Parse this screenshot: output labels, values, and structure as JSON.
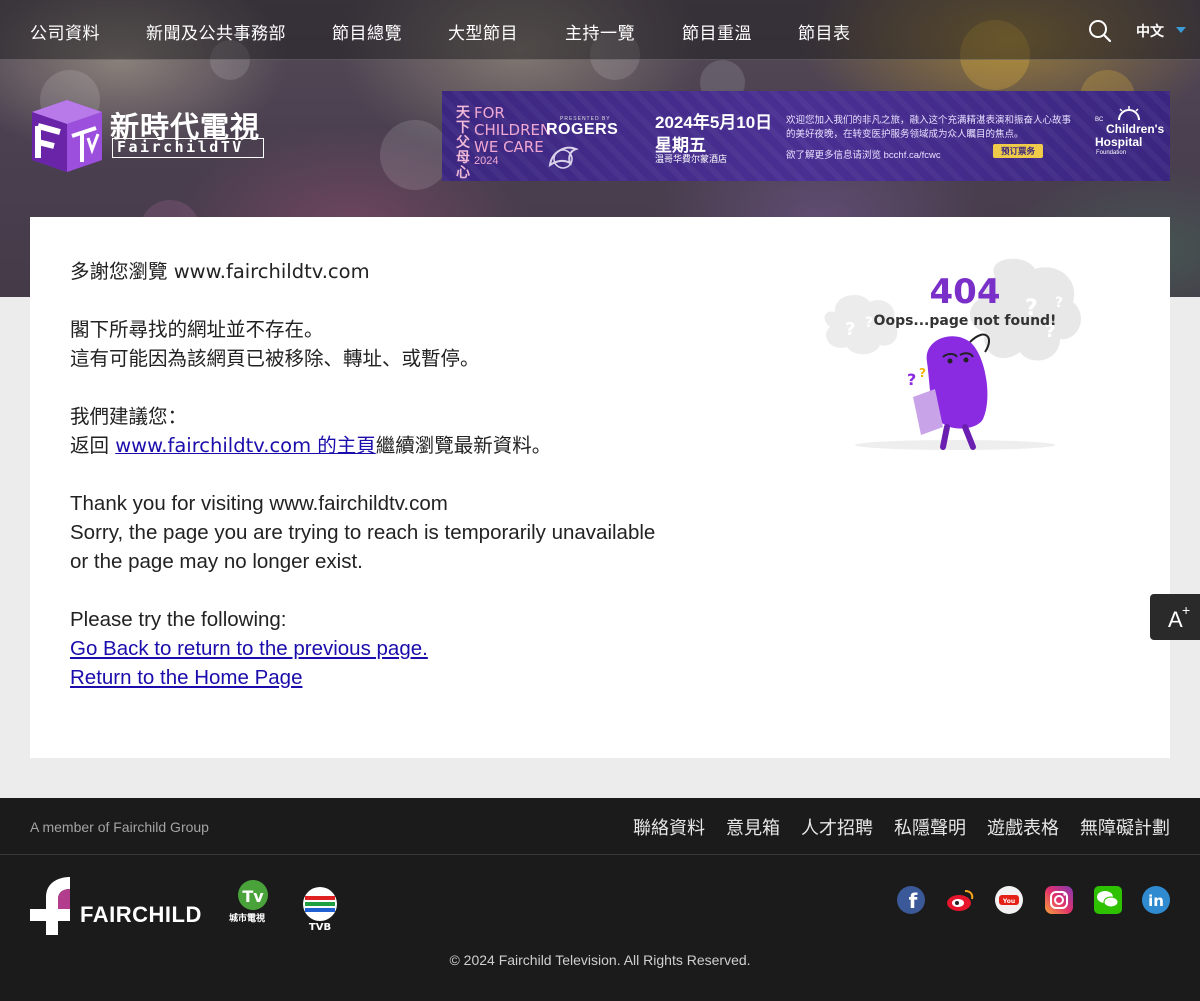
{
  "nav": {
    "items": [
      "公司資料",
      "新聞及公共事務部",
      "節目總覽",
      "大型節目",
      "主持一覽",
      "節目重溫",
      "節目表"
    ],
    "language": "中文"
  },
  "logo": {
    "chinese": "新時代電視",
    "english": "FairchildTV",
    "cube_text": "FTV"
  },
  "banner": {
    "vertical_text": "天下父母心",
    "for_children": "FOR\nCHILDREN\nWE CARE",
    "year": "2024",
    "presented_by": "PRESENTED BY",
    "sponsor": "ROGERS",
    "date": "2024年5月10日",
    "weekday": "星期五",
    "venue": "温哥华費尔蒙酒店",
    "line1": "欢迎您加入我们的非凡之旅，融入这个充满精湛表演和振奋人心故事",
    "line2": "的美好夜晚，在转变医护服务领域成为众人瞩目的焦点。",
    "line3": "欲了解更多信息请浏览 bcchf.ca/fcwc",
    "button": "预订票务",
    "bc": "BC",
    "charity1": "Children's",
    "charity2": "Hospital",
    "charity3": "Foundation"
  },
  "message": {
    "zh_thanks": "多謝您瀏覽 www.fairchildtv.com",
    "zh_notfound": "閣下所尋找的網址並不存在。",
    "zh_reason": "這有可能因為該網頁已被移除、轉址、或暫停。",
    "zh_suggest": "我們建議您：",
    "zh_return_prefix": "返回 ",
    "zh_return_link": "www.fairchildtv.com 的主頁",
    "zh_return_suffix": "繼續瀏覽最新資料。",
    "en_thanks": "Thank you for visiting www.fairchildtv.com",
    "en_sorry": "Sorry, the page you are trying to reach is temporarily unavailable",
    "en_exist": "or the page may no longer exist.",
    "en_try": "Please try the following:",
    "en_back": "Go Back to return to the previous page.",
    "en_home": "Return to the Home Page"
  },
  "illustration": {
    "code": "404",
    "caption": "Oops...page not found!"
  },
  "font_button": {
    "letter": "A",
    "plus": "+"
  },
  "footer": {
    "member": "A member of Fairchild Group",
    "links": [
      "聯絡資料",
      "意見箱",
      "人才招聘",
      "私隱聲明",
      "遊戲表格",
      "無障礙計劃"
    ],
    "brand": "FAIRCHILD",
    "talentvision_zh": "城市電視",
    "tvb": "TVB",
    "social": [
      "facebook",
      "weibo",
      "youtube",
      "instagram",
      "wechat",
      "linkedin"
    ],
    "copyright": "© 2024 Fairchild Television. All Rights Reserved."
  },
  "colors": {
    "brand_purple": "#7b2fc9",
    "accent_blue": "#3b9bd6",
    "banner_purple": "#4a2f93",
    "link": "#1a0dab"
  }
}
